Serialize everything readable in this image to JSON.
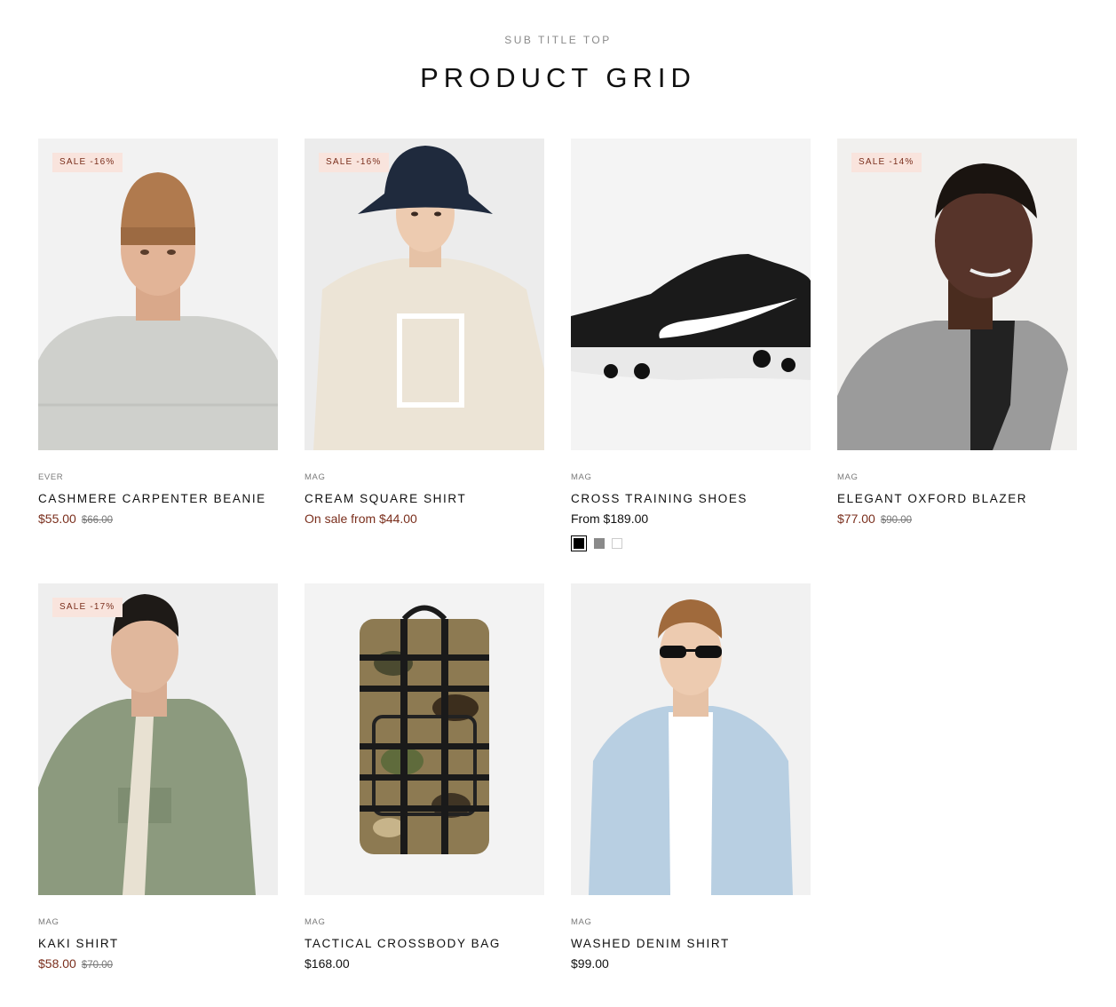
{
  "header": {
    "subtitle": "SUB TITLE TOP",
    "title": "PRODUCT GRID"
  },
  "colors": {
    "sale_text": "#7a2e1c",
    "badge_bg": "#f9e4dd",
    "image_bg": "#f1f1f1"
  },
  "products": [
    {
      "badge": "SALE -16%",
      "vendor": "EVER",
      "name": "CASHMERE CARPENTER BEANIE",
      "price": "$55.00",
      "compare": "$66.00",
      "image": "man-in-beanie-photo"
    },
    {
      "badge": "SALE -16%",
      "vendor": "MAG",
      "name": "CREAM SQUARE SHIRT",
      "price": "On sale from $44.00",
      "compare": "",
      "image": "man-in-bucket-hat-photo"
    },
    {
      "badge": "",
      "vendor": "MAG",
      "name": "CROSS TRAINING SHOES",
      "price": "From $189.00",
      "compare": "",
      "image": "sneaker-photo",
      "swatches": [
        "black",
        "grey",
        "white"
      ]
    },
    {
      "badge": "SALE -14%",
      "vendor": "MAG",
      "name": "ELEGANT OXFORD BLAZER",
      "price": "$77.00",
      "compare": "$90.00",
      "image": "man-in-blazer-photo"
    },
    {
      "badge": "SALE -17%",
      "vendor": "MAG",
      "name": "KAKI SHIRT",
      "price": "$58.00",
      "compare": "$70.00",
      "image": "man-in-khaki-shirt-photo"
    },
    {
      "badge": "",
      "vendor": "MAG",
      "name": "TACTICAL CROSSBODY BAG",
      "price": "$168.00",
      "compare": "",
      "image": "camo-backpack-photo"
    },
    {
      "badge": "",
      "vendor": "MAG",
      "name": "WASHED DENIM SHIRT",
      "price": "$99.00",
      "compare": "",
      "image": "man-in-denim-shirt-photo"
    }
  ]
}
